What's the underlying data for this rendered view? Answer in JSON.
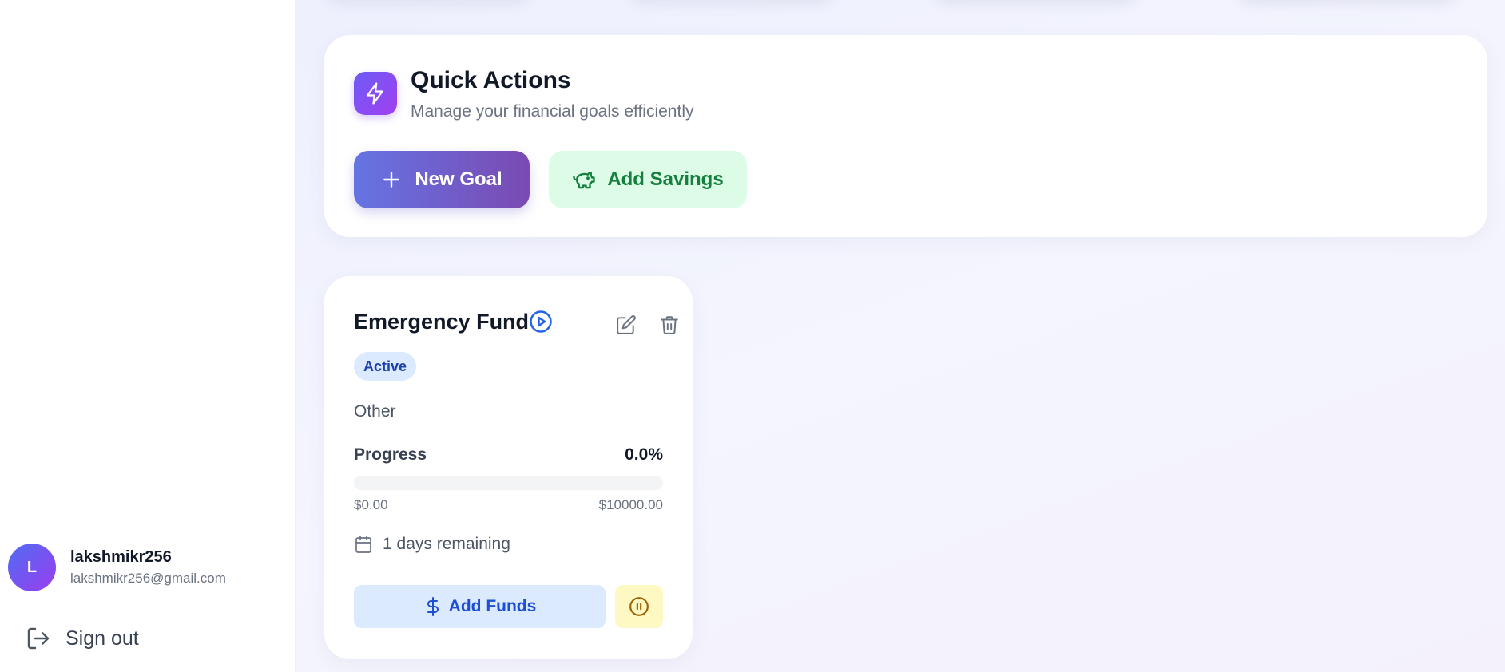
{
  "user": {
    "avatar_initial": "L",
    "name": "lakshmikr256",
    "email": "lakshmikr256@gmail.com"
  },
  "sidebar": {
    "signout_label": "Sign out",
    "signout_icon": "log-out-icon"
  },
  "quick_actions": {
    "icon": "lightning-icon",
    "title": "Quick Actions",
    "subtitle": "Manage your financial goals efficiently",
    "new_goal_label": "New Goal",
    "new_goal_icon": "plus-icon",
    "add_savings_label": "Add Savings",
    "add_savings_icon": "piggy-bank-icon"
  },
  "goal": {
    "title": "Emergency Fund",
    "status_icon": "play-circle-icon",
    "status": "Active",
    "category": "Other",
    "progress_label": "Progress",
    "progress_text": "0.0%",
    "progress_percent": 0,
    "current_amount": "$0.00",
    "target_amount": "$10000.00",
    "deadline_icon": "calendar-icon",
    "deadline_text": "1 days remaining",
    "add_funds_label": "Add Funds",
    "add_funds_icon": "dollar-icon",
    "pause_icon": "pause-circle-icon",
    "edit_icon": "edit-icon",
    "delete_icon": "trash-icon"
  },
  "colors": {
    "primary_gradient_start": "#6574e3",
    "primary_gradient_end": "#7b4ab3",
    "savings_bg": "#dcfce7",
    "savings_text": "#15803d",
    "active_badge_bg": "#dbeafe",
    "active_badge_text": "#1e40af",
    "pause_bg": "#fef9c3",
    "pause_icon": "#a16207"
  }
}
